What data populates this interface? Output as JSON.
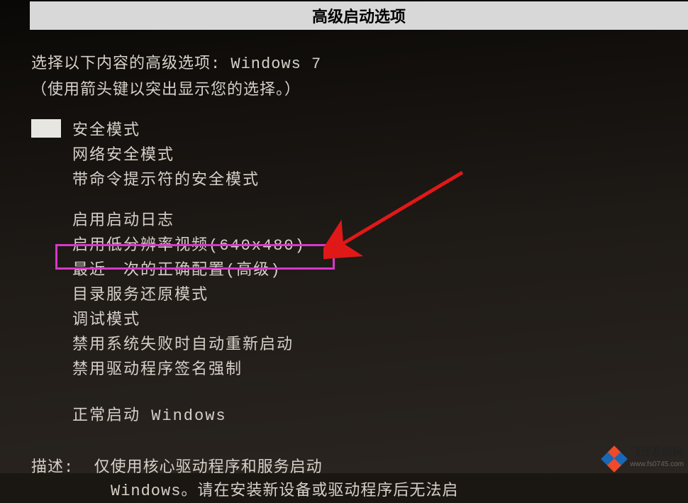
{
  "title_bar": "高级启动选项",
  "intro1_a": "选择以下内容的高级选项: ",
  "intro1_b": "Windows 7",
  "intro2": "（使用箭头键以突出显示您的选择。）",
  "group1": {
    "opt0": "安全模式",
    "opt1": "网络安全模式",
    "opt2": "带命令提示符的安全模式"
  },
  "group2": {
    "opt0": "启用启动日志",
    "opt1": "启用低分辨率视频(640x480)",
    "opt2": "最近一次的正确配置(高级)",
    "opt3": "目录服务还原模式",
    "opt4": "调试模式",
    "opt5": "禁用系统失败时自动重新启动",
    "opt6": "禁用驱动程序签名强制"
  },
  "group3": {
    "opt0": "正常启动 Windows"
  },
  "desc_label": "描述:",
  "desc1": "仅使用核心驱动程序和服务启动",
  "desc2": "Windows。请在安装新设备或驱动程序后无法启",
  "watermark": {
    "name": "飞沙系统网",
    "url": "www.fs0745.com"
  }
}
